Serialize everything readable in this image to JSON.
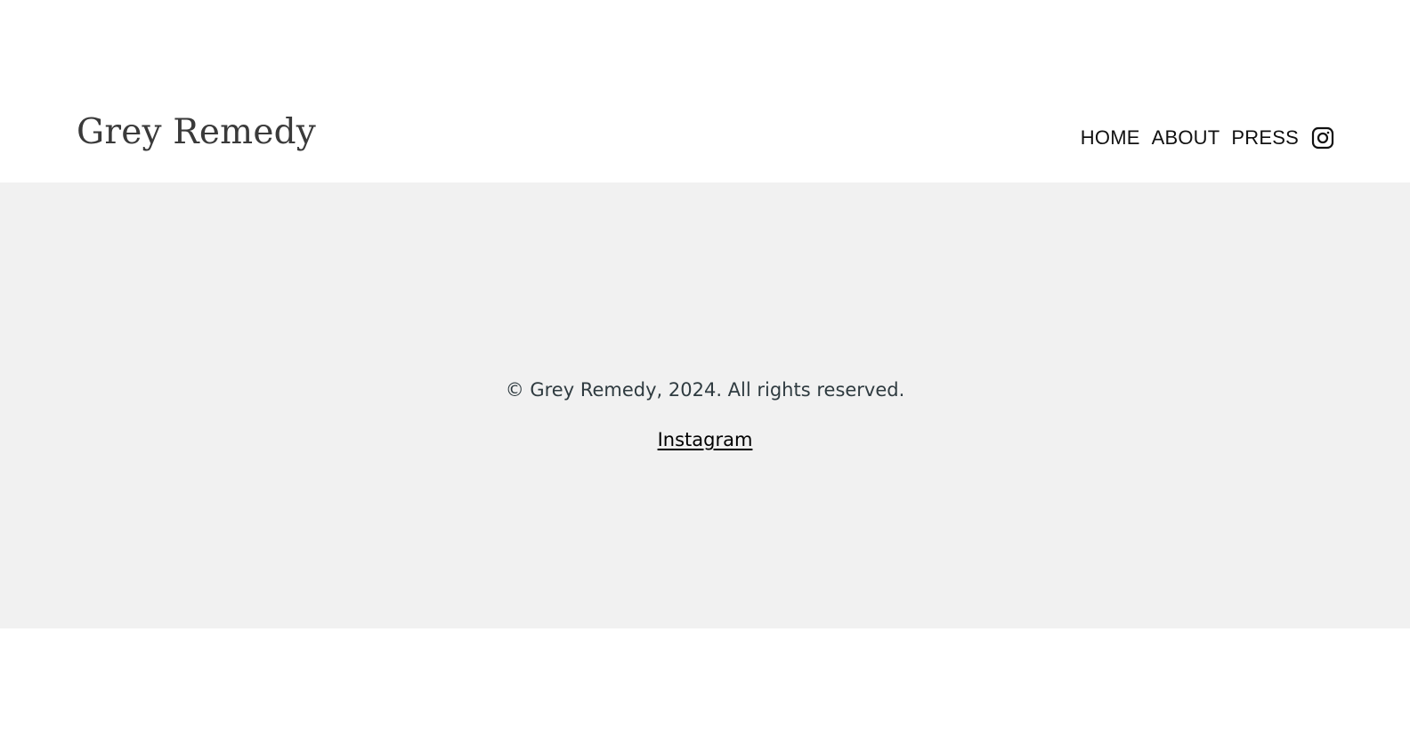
{
  "header": {
    "brand": "Grey Remedy",
    "nav": {
      "home": "HOME",
      "about": "ABOUT",
      "press": "PRESS",
      "instagram_icon": "instagram-icon"
    }
  },
  "footer": {
    "copyright": "© Grey Remedy, 2024. All rights reserved.",
    "instagram_link": "Instagram",
    "background": "#f1f1f1"
  }
}
